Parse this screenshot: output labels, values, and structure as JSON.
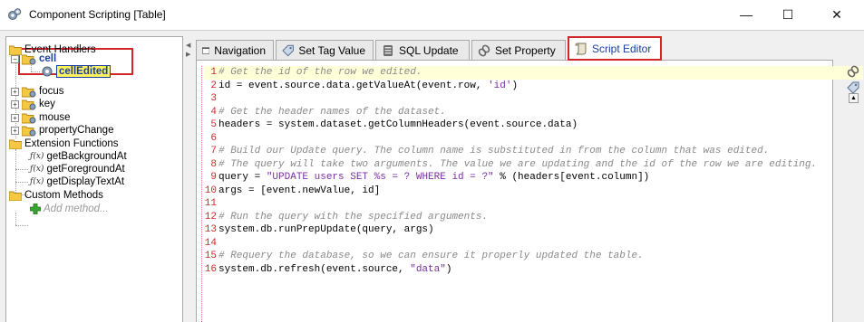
{
  "window": {
    "title": "Component Scripting [Table]",
    "minimize": "—",
    "maximize": "☐",
    "close": "✕",
    "app_icon": "gear-scripting-icon"
  },
  "tree": {
    "event_handlers": "Event Handlers",
    "cell": "cell",
    "cell_edited": "cellEdited",
    "focus": "focus",
    "key": "key",
    "mouse": "mouse",
    "property_change": "propertyChange",
    "extension_functions": "Extension Functions",
    "fx_prefix": "ƒ(x)",
    "get_background": "getBackgroundAt",
    "get_foreground": "getForegroundAt",
    "get_display_text": "getDisplayTextAt",
    "custom_methods": "Custom Methods",
    "add_method": "Add method..."
  },
  "tabs": [
    {
      "label": "Navigation",
      "icon": "window-icon"
    },
    {
      "label": "Set Tag Value",
      "icon": "tag-icon"
    },
    {
      "label": "SQL Update",
      "icon": "database-icon"
    },
    {
      "label": "Set Property",
      "icon": "link-icon"
    },
    {
      "label": "Script Editor",
      "icon": "script-icon"
    }
  ],
  "code": {
    "lines": [
      {
        "n": "1",
        "parts": [
          [
            "cm",
            "# Get the id of the row we edited."
          ]
        ]
      },
      {
        "n": "2",
        "parts": [
          [
            "kw",
            "id = event.source.data.getValueAt(event.row, "
          ],
          [
            "st",
            "'id'"
          ],
          [
            "kw",
            ")"
          ]
        ]
      },
      {
        "n": "3",
        "parts": []
      },
      {
        "n": "4",
        "parts": [
          [
            "cm",
            "# Get the header names of the dataset."
          ]
        ]
      },
      {
        "n": "5",
        "parts": [
          [
            "kw",
            "headers = system.dataset.getColumnHeaders(event.source.data)"
          ]
        ]
      },
      {
        "n": "6",
        "parts": []
      },
      {
        "n": "7",
        "parts": [
          [
            "cm",
            "# Build our Update query. The column name is substituted in from the column that was edited."
          ]
        ]
      },
      {
        "n": "8",
        "parts": [
          [
            "cm",
            "# The query will take two arguments. The value we are updating and the id of the row we are editing."
          ]
        ]
      },
      {
        "n": "9",
        "parts": [
          [
            "kw",
            "query = "
          ],
          [
            "st",
            "\"UPDATE users SET %s = ? WHERE id = ?\""
          ],
          [
            "kw",
            " % (headers[event.column])"
          ]
        ]
      },
      {
        "n": "10",
        "parts": [
          [
            "kw",
            "args = [event.newValue, id]"
          ]
        ]
      },
      {
        "n": "11",
        "parts": []
      },
      {
        "n": "12",
        "parts": [
          [
            "cm",
            "# Run the query with the specified arguments."
          ]
        ]
      },
      {
        "n": "13",
        "parts": [
          [
            "kw",
            "system.db.runPrepUpdate(query, args)"
          ]
        ]
      },
      {
        "n": "14",
        "parts": []
      },
      {
        "n": "15",
        "parts": [
          [
            "cm",
            "# Requery the database, so we can ensure it properly updated the table."
          ]
        ]
      },
      {
        "n": "16",
        "parts": [
          [
            "kw",
            "system.db.refresh(event.source, "
          ],
          [
            "st",
            "\"data\""
          ],
          [
            "kw",
            ")"
          ]
        ]
      }
    ]
  },
  "side": {
    "link_icon": "link-icon",
    "tag_icon": "tag-icon"
  },
  "colors": {
    "highlight_red": "#d3262a",
    "selection_yellow": "#fff25e",
    "string_purple": "#7a2fa0",
    "comment_gray": "#8a8a8a"
  }
}
